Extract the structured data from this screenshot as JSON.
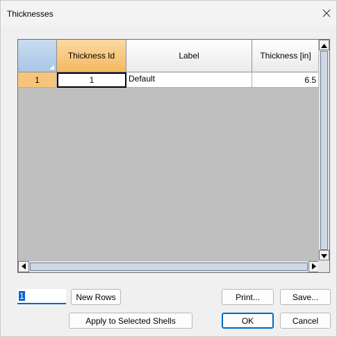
{
  "window": {
    "title": "Thicknesses"
  },
  "grid": {
    "columns": [
      "Thickness Id",
      "Label",
      "Thickness [in]"
    ],
    "rows": [
      {
        "row_header": "1",
        "thickness_id": "1",
        "label": "Default",
        "thickness": "6.5"
      }
    ]
  },
  "footer": {
    "rows_count_value": "1",
    "new_rows_label": "New Rows",
    "print_label": "Print...",
    "save_label": "Save...",
    "apply_label": "Apply to Selected Shells",
    "ok_label": "OK",
    "cancel_label": "Cancel"
  },
  "colors": {
    "header_selected": "#f4b95f",
    "row_header_selected": "#f7c57a",
    "grid_background": "#bfbfbf",
    "accent": "#0067c0"
  },
  "icons": [
    "close-icon",
    "scroll-up-arrow-icon",
    "scroll-down-arrow-icon",
    "scroll-left-arrow-icon",
    "scroll-right-arrow-icon",
    "select-all-corner-icon"
  ]
}
